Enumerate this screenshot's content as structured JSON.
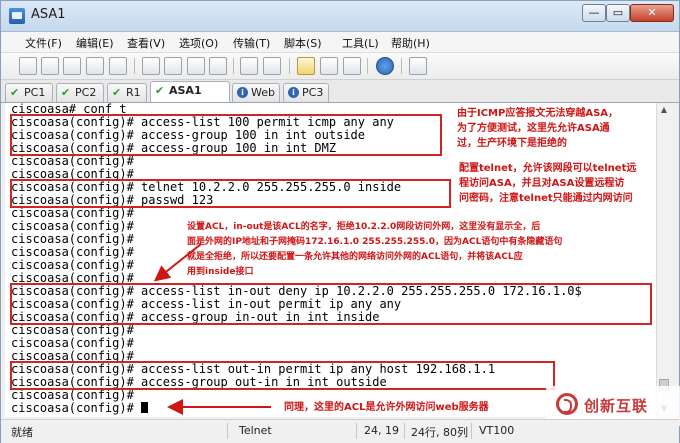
{
  "window": {
    "title": "ASA1",
    "min_glyph": "—",
    "max_glyph": "▭",
    "close_glyph": "✕"
  },
  "menu": [
    "文件(F)",
    "编辑(E)",
    "查看(V)",
    "选项(O)",
    "传输(T)",
    "脚本(S)",
    "工具(L)",
    "帮助(H)"
  ],
  "toolbar_icons": [
    "connect-icon",
    "quick-connect-icon",
    "reconnect-icon",
    "reconnect-all-icon",
    "disconnect-icon",
    "copy-icon",
    "paste-icon",
    "copy-paste-icon",
    "find-icon",
    "print-setup-icon",
    "print-icon",
    "print-selection-icon",
    "session-options-icon",
    "global-options-icon",
    "keymap-icon",
    "help-icon",
    "about-icon"
  ],
  "tabs": [
    {
      "label": "PC1",
      "icon": "check",
      "active": false
    },
    {
      "label": "PC2",
      "icon": "check",
      "active": false
    },
    {
      "label": "R1",
      "icon": "check",
      "active": false
    },
    {
      "label": "ASA1",
      "icon": "check",
      "active": true
    },
    {
      "label": "Web",
      "icon": "info",
      "active": false
    },
    {
      "label": "PC3",
      "icon": "info",
      "active": false
    }
  ],
  "terminal": {
    "lines": [
      "ciscoasa# conf t",
      "ciscoasa(config)# access-list 100 permit icmp any any",
      "ciscoasa(config)# access-group 100 in int outside",
      "ciscoasa(config)# access-group 100 in int DMZ",
      "ciscoasa(config)#",
      "ciscoasa(config)#",
      "ciscoasa(config)# telnet 10.2.2.0 255.255.255.0 inside",
      "ciscoasa(config)# passwd 123",
      "ciscoasa(config)#",
      "ciscoasa(config)#",
      "ciscoasa(config)#",
      "ciscoasa(config)#",
      "ciscoasa(config)#",
      "ciscoasa(config)#",
      "ciscoasa(config)# access-list in-out deny ip 10.2.2.0 255.255.255.0 172.16.1.0$",
      "ciscoasa(config)# access-list in-out permit ip any any",
      "ciscoasa(config)# access-group in-out in int inside",
      "ciscoasa(config)#",
      "ciscoasa(config)#",
      "ciscoasa(config)#",
      "ciscoasa(config)# access-list out-in permit ip any host 192.168.1.1",
      "ciscoasa(config)# access-group out-in in int outside",
      "ciscoasa(config)#",
      "ciscoasa(config)# "
    ]
  },
  "annotations": [
    "由于ICMP应答报文无法穿越ASA，\n为了方便测试，这里先允许ASA通\n过，生产环境下是拒绝的",
    "配置telnet，允许该网段可以telnet远\n程访问ASA，并且对ASA设置远程访\n问密码，注意telnet只能通过内网访问",
    "设置ACL，in-out是该ACL的名字，拒绝10.2.2.0网段访问外网，这里没有显示全，后\n面是外网的IP地址和子网掩码172.16.1.0 255.255.255.0，因为ACL语句中有条隐藏语句\n就是全拒绝，所以还要配置一条允许其他的网络访问外网的ACL语句，并将该ACL应\n用到inside接口",
    "同理，这里的ACL是允许外网访问web服务器"
  ],
  "status": {
    "ready": "就绪",
    "protocol": "Telnet",
    "position": "24,  19",
    "size": "24行, 80列",
    "terminal_type": "VT100"
  },
  "watermark": {
    "text": "创新互联"
  },
  "colors": {
    "annotation": "#d01515",
    "box": "#d02525"
  }
}
